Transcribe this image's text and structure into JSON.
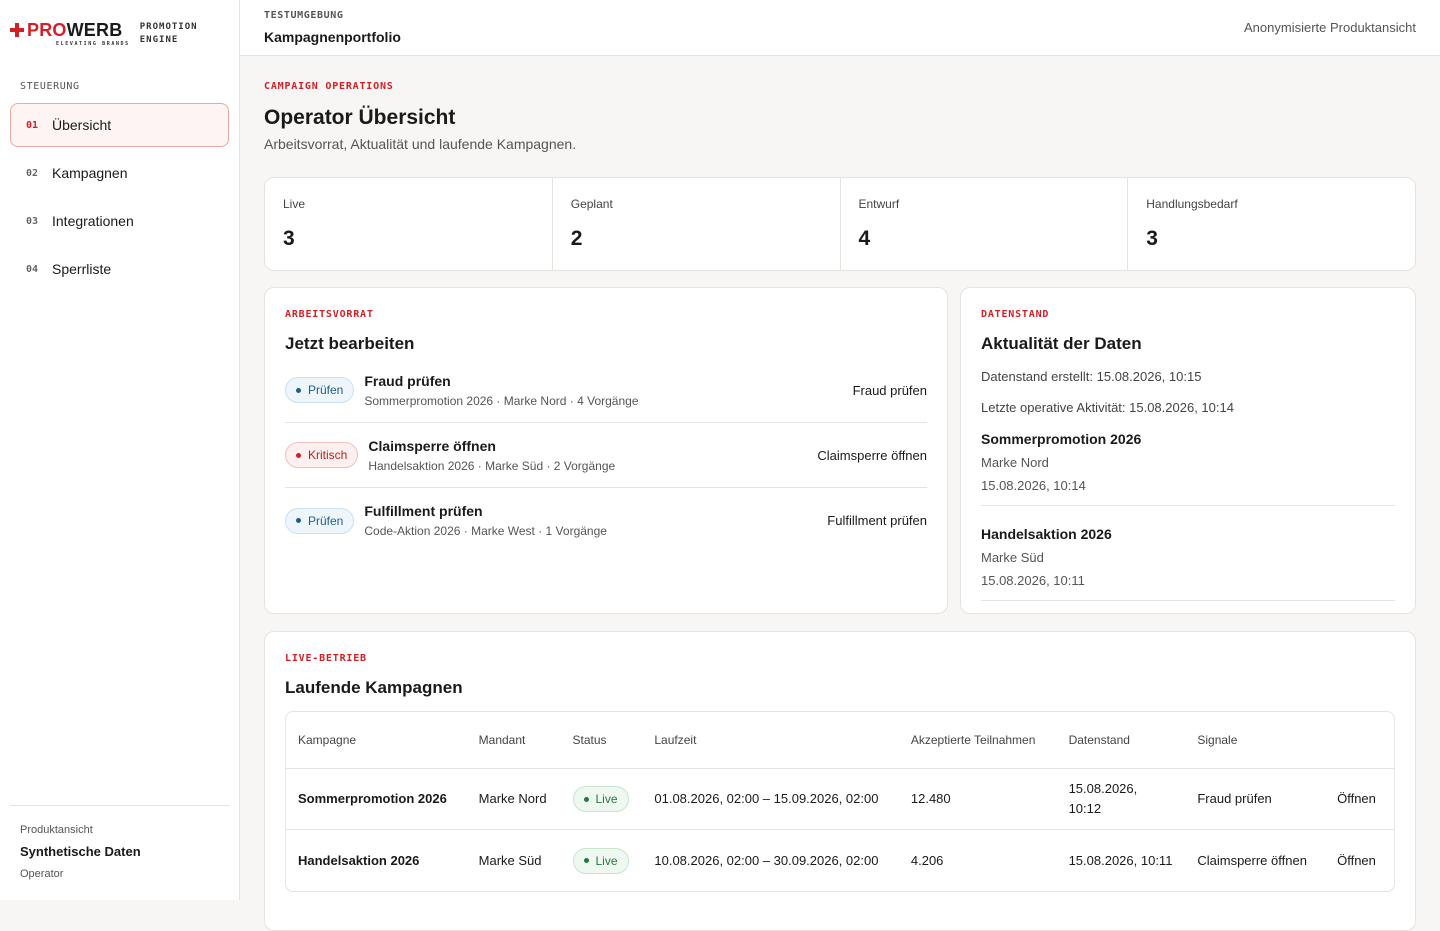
{
  "brand": {
    "name_a": "PRO",
    "name_b": "WERB",
    "tagline": "ELEVATING BRANDS",
    "engine_1": "PROMOTION",
    "engine_2": "ENGINE"
  },
  "sidebar": {
    "title": "STEUERUNG",
    "items": [
      {
        "num": "01",
        "label": "Übersicht",
        "active": true
      },
      {
        "num": "02",
        "label": "Kampagnen"
      },
      {
        "num": "03",
        "label": "Integrationen"
      },
      {
        "num": "04",
        "label": "Sperrliste"
      }
    ],
    "footer": {
      "label": "Produktansicht",
      "value": "Synthetische Daten",
      "role": "Operator"
    }
  },
  "topbar": {
    "env": "TESTUMGEBUNG",
    "page": "Kampagnenportfolio",
    "right": "Anonymisierte Produktansicht"
  },
  "header": {
    "eyebrow": "CAMPAIGN OPERATIONS",
    "title": "Operator Übersicht",
    "subtitle": "Arbeitsvorrat, Aktualität und laufende Kampagnen."
  },
  "stats": [
    {
      "label": "Live",
      "value": "3"
    },
    {
      "label": "Geplant",
      "value": "2"
    },
    {
      "label": "Entwurf",
      "value": "4"
    },
    {
      "label": "Handlungsbedarf",
      "value": "3"
    }
  ],
  "work": {
    "eyebrow": "ARBEITSVORRAT",
    "title": "Jetzt bearbeiten",
    "items": [
      {
        "badge": "Prüfen",
        "badge_kind": "pruefen",
        "title": "Fraud prüfen",
        "meta": "Sommerpromotion 2026 · Marke Nord · 4 Vorgänge",
        "action": "Fraud prüfen"
      },
      {
        "badge": "Kritisch",
        "badge_kind": "kritisch",
        "title": "Claimsperre öffnen",
        "meta": "Handelsaktion 2026 · Marke Süd · 2 Vorgänge",
        "action": "Claimsperre öffnen"
      },
      {
        "badge": "Prüfen",
        "badge_kind": "pruefen",
        "title": "Fulfillment prüfen",
        "meta": "Code-Aktion 2026 · Marke West · 1 Vorgänge",
        "action": "Fulfillment prüfen"
      }
    ]
  },
  "freshness": {
    "eyebrow": "DATENSTAND",
    "title": "Aktualität der Daten",
    "created": "Datenstand erstellt: 15.08.2026, 10:15",
    "last_activity": "Letzte operative Aktivität: 15.08.2026, 10:14",
    "items": [
      {
        "title": "Sommerpromotion 2026",
        "brand": "Marke Nord",
        "date": "15.08.2026, 10:14"
      },
      {
        "title": "Handelsaktion 2026",
        "brand": "Marke Süd",
        "date": "15.08.2026, 10:11"
      }
    ]
  },
  "live": {
    "eyebrow": "LIVE-BETRIEB",
    "title": "Laufende Kampagnen",
    "columns": [
      "Kampagne",
      "Mandant",
      "Status",
      "Laufzeit",
      "Akzeptierte Teilnahmen",
      "Datenstand",
      "Signale",
      ""
    ],
    "rows": [
      {
        "campaign": "Sommerpromotion 2026",
        "client": "Marke Nord",
        "status": "Live",
        "period": "01.08.2026, 02:00 – 15.09.2026, 02:00",
        "accepted": "12.480",
        "data": "15.08.2026, 10:12",
        "signal": "Fraud prüfen",
        "action": "Öffnen"
      },
      {
        "campaign": "Handelsaktion 2026",
        "client": "Marke Süd",
        "status": "Live",
        "period": "10.08.2026, 02:00 – 30.09.2026, 02:00",
        "accepted": "4.206",
        "data": "15.08.2026, 10:11",
        "signal": "Claimsperre öffnen",
        "action": "Öffnen"
      }
    ]
  }
}
